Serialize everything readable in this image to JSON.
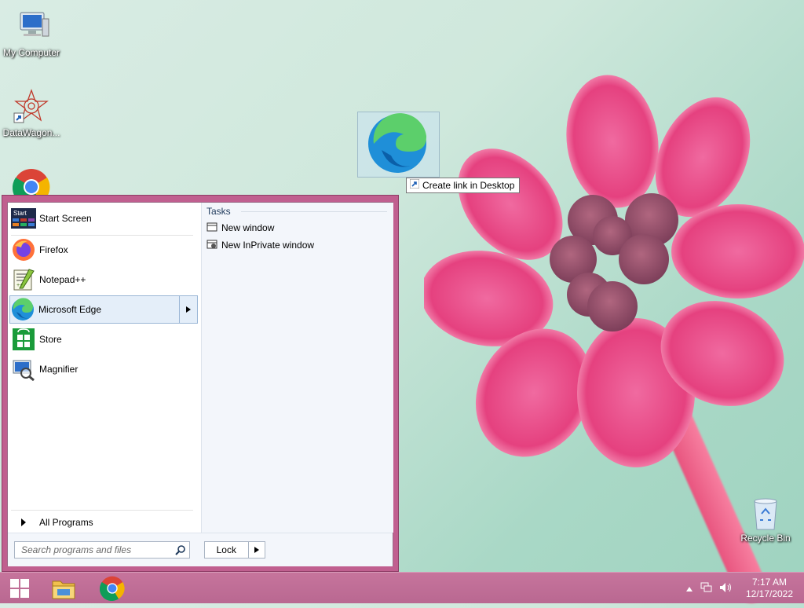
{
  "desktop": {
    "icons": [
      {
        "label": "My Computer"
      },
      {
        "label": "DataWagon..."
      },
      {
        "label": "Recycle Bin"
      }
    ],
    "drag_tooltip": "Create link in Desktop"
  },
  "start_menu": {
    "programs": [
      {
        "label": "Start Screen",
        "icon": "start-screen-icon"
      },
      {
        "label": "Firefox",
        "icon": "firefox-icon"
      },
      {
        "label": "Notepad++",
        "icon": "notepadpp-icon"
      },
      {
        "label": "Microsoft Edge",
        "icon": "edge-icon",
        "selected": true
      },
      {
        "label": "Store",
        "icon": "store-icon"
      },
      {
        "label": "Magnifier",
        "icon": "magnifier-icon"
      }
    ],
    "all_programs": "All Programs",
    "jumplist": {
      "title": "Tasks",
      "items": [
        {
          "label": "New window",
          "icon": "window-icon"
        },
        {
          "label": "New InPrivate window",
          "icon": "inprivate-icon"
        }
      ]
    },
    "search": {
      "placeholder": "Search programs and files"
    },
    "power_button": "Lock"
  },
  "taskbar": {
    "clock_time": "7:17 AM",
    "clock_date": "12/17/2022"
  },
  "colors": {
    "accent": "#c05f8f",
    "taskbar": "#bd6c95",
    "selection": "#e4eef9"
  }
}
